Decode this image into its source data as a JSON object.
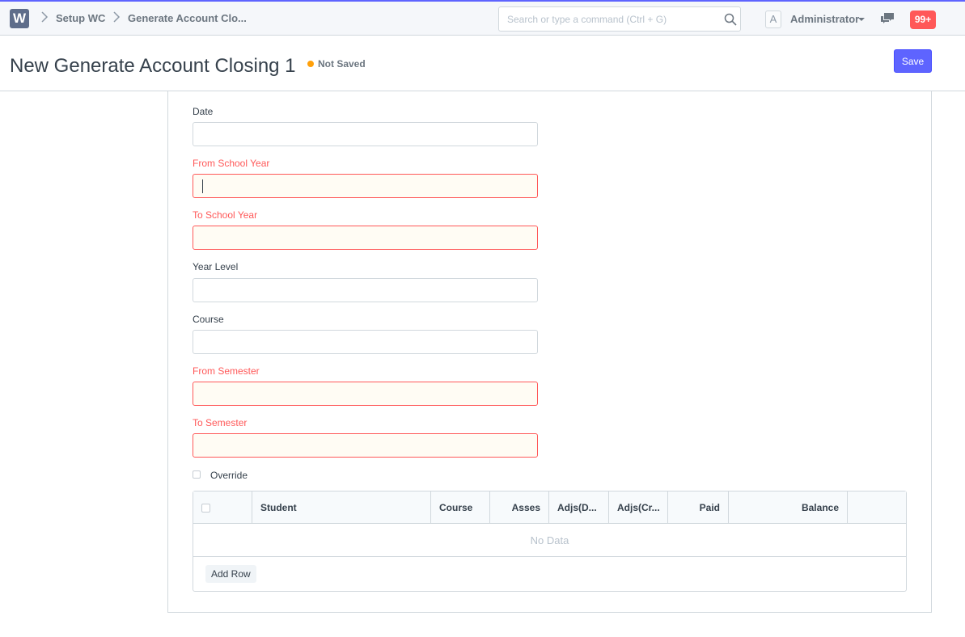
{
  "app": {
    "logo_letter": "W"
  },
  "breadcrumbs": [
    "Setup WC",
    "Generate Account Clo..."
  ],
  "search": {
    "placeholder": "Search or type a command (Ctrl + G)"
  },
  "user": {
    "avatar_letter": "A",
    "name": "Administrator"
  },
  "notifications": {
    "count": "99+"
  },
  "page": {
    "title": "New Generate Account Closing 1",
    "status": "Not Saved"
  },
  "actions": {
    "save_label": "Save"
  },
  "form": {
    "fields": [
      {
        "label": "Date",
        "value": "",
        "required": false
      },
      {
        "label": "From School Year",
        "value": "",
        "required": true
      },
      {
        "label": "To School Year",
        "value": "",
        "required": true
      },
      {
        "label": "Year Level",
        "value": "",
        "required": false
      },
      {
        "label": "Course",
        "value": "",
        "required": false
      },
      {
        "label": "From Semester",
        "value": "",
        "required": true
      },
      {
        "label": "To Semester",
        "value": "",
        "required": true
      }
    ],
    "override": {
      "label": "Override",
      "checked": false
    }
  },
  "table": {
    "columns": [
      "Student",
      "Course",
      "Asses",
      "Adjs(D...",
      "Adjs(Cr...",
      "Paid",
      "Balance"
    ],
    "empty_text": "No Data",
    "add_row_label": "Add Row"
  },
  "colors": {
    "primary": "#5e64ff",
    "required": "#ff5858",
    "status_dot": "#ffa00a",
    "badge": "#ff5858"
  }
}
